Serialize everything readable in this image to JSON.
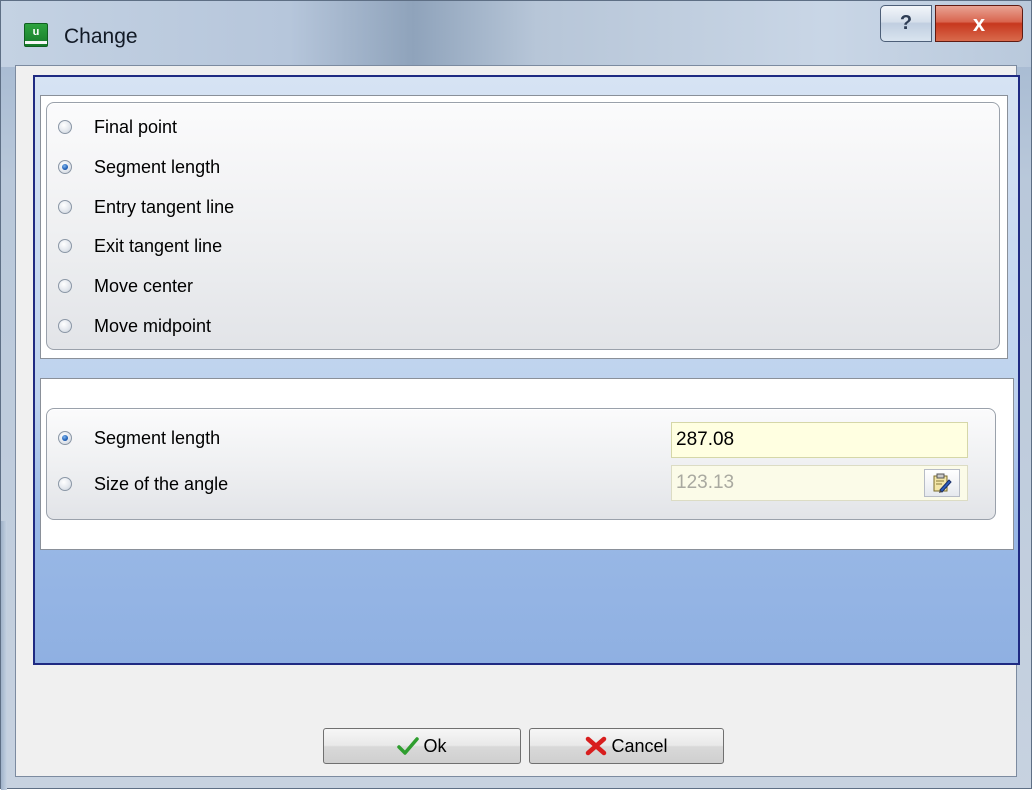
{
  "window": {
    "title": "Change",
    "help_label": "?",
    "close_label": "x"
  },
  "modes": {
    "options": [
      {
        "label": "Final point",
        "checked": false
      },
      {
        "label": "Segment length",
        "checked": true
      },
      {
        "label": "Entry tangent line",
        "checked": false
      },
      {
        "label": "Exit tangent line",
        "checked": false
      },
      {
        "label": "Move center",
        "checked": false
      },
      {
        "label": "Move midpoint",
        "checked": false
      }
    ]
  },
  "params": {
    "segment_length": {
      "label": "Segment length",
      "value": "287.08",
      "checked": true
    },
    "angle": {
      "label": "Size of the angle",
      "value": "123.13",
      "checked": false
    }
  },
  "buttons": {
    "ok": "Ok",
    "cancel": "Cancel"
  },
  "colors": {
    "accent": "#1f2a82",
    "field_bg": "#ffffe1"
  },
  "icons": {
    "app": "app-logo-icon",
    "ok": "checkmark-icon",
    "cancel": "red-x-icon",
    "edit": "edit-pencil-icon"
  }
}
